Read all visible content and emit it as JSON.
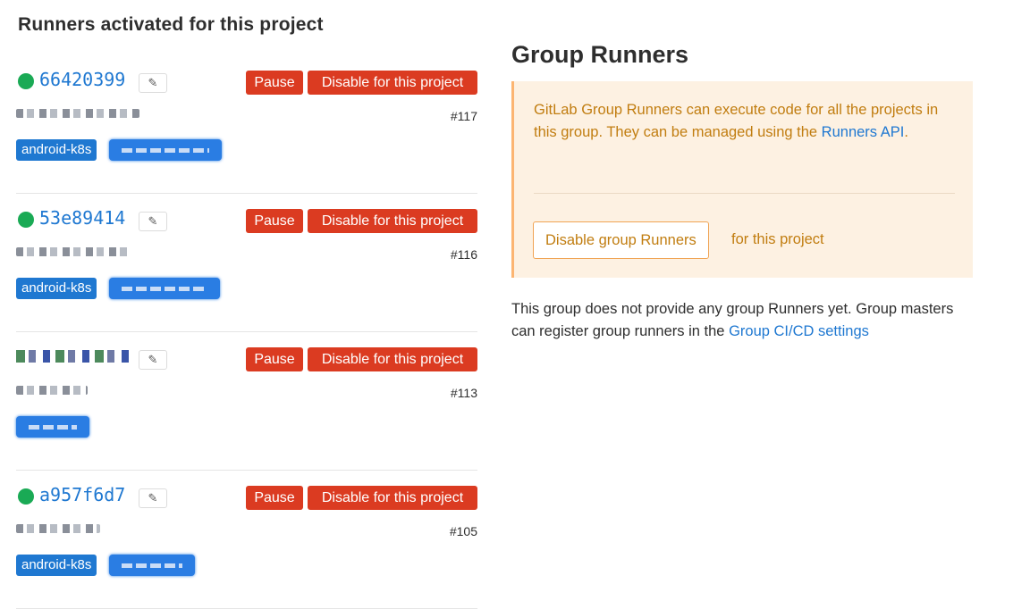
{
  "left_title": "Runners activated for this project",
  "runners": [
    {
      "token": "66420399",
      "id": "#117",
      "tag": "android-k8s",
      "pause_label": "Pause",
      "disable_label": "Disable for this project",
      "status": "online"
    },
    {
      "token": "53e89414",
      "id": "#116",
      "tag": "android-k8s",
      "pause_label": "Pause",
      "disable_label": "Disable for this project",
      "status": "online"
    },
    {
      "token": "",
      "id": "#113",
      "tag": "",
      "pause_label": "Pause",
      "disable_label": "Disable for this project",
      "status": "redacted"
    },
    {
      "token": "a957f6d7",
      "id": "#105",
      "tag": "android-k8s",
      "pause_label": "Pause",
      "disable_label": "Disable for this project",
      "status": "online"
    }
  ],
  "group": {
    "title": "Group Runners",
    "notice_text": "GitLab Group Runners can execute code for all the projects in this group. They can be managed using the ",
    "notice_link": "Runners API",
    "notice_end": ".",
    "disable_button": "Disable group Runners",
    "for_project": "for this project",
    "info_text": "This group does not provide any group Runners yet. Group masters can register group runners in the ",
    "info_link": "Group CI/CD settings"
  },
  "colors": {
    "danger": "#db3b21",
    "link": "#1f78d1",
    "online": "#1aaa55",
    "warning_bg": "#fdf1e2",
    "warning_text": "#c17d10"
  },
  "icons": {
    "edit": "edit-icon",
    "status": "status-dot-icon"
  }
}
